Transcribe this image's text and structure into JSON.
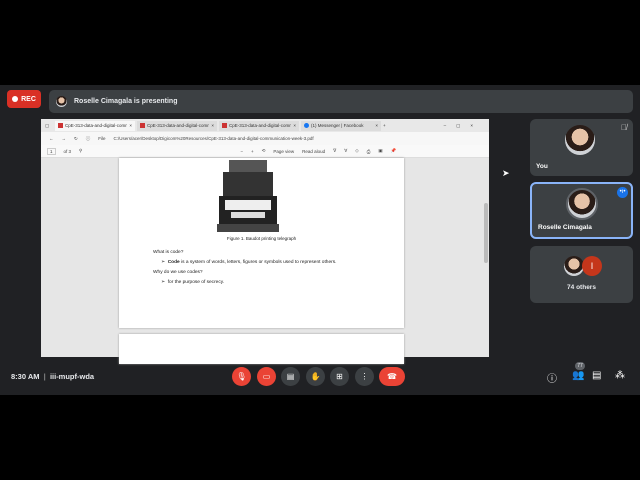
{
  "recording": {
    "label": "REC"
  },
  "presenting": {
    "text": "Roselle Cimagala is presenting"
  },
  "browser": {
    "tabs": [
      "CpE-313-data-and-digital-comm",
      "CpE-313-data-and-digital-comm",
      "CpE-313-data-and-digital-comm",
      "(1) Messenger | Facebook"
    ],
    "address_prefix": "File",
    "address": "C:/Users/acer/Desktop/Digicom%20Resources/CpE-313-data-and-digital-communication-week-3.pdf",
    "page_number": "1",
    "page_total": "of 3",
    "page_view": "Page view",
    "read_aloud": "Read aloud"
  },
  "pdf": {
    "caption": "Figure 1. Baudot printing telegraph",
    "q1": "What is code?",
    "a1_bold": "Code",
    "a1": " is a system of words, letters, figures or symbols used to represent others.",
    "q2": "Why do we use codes?",
    "a2": "for the purpose of secrecy."
  },
  "participants": [
    {
      "name": "You"
    },
    {
      "name": "Roselle Cimagala"
    },
    {
      "name": "74 others",
      "initial": "I"
    }
  ],
  "bottom": {
    "time": "8:30 AM",
    "separator": "|",
    "meeting_code": "iii-mupf-wda",
    "people_count": "77"
  }
}
